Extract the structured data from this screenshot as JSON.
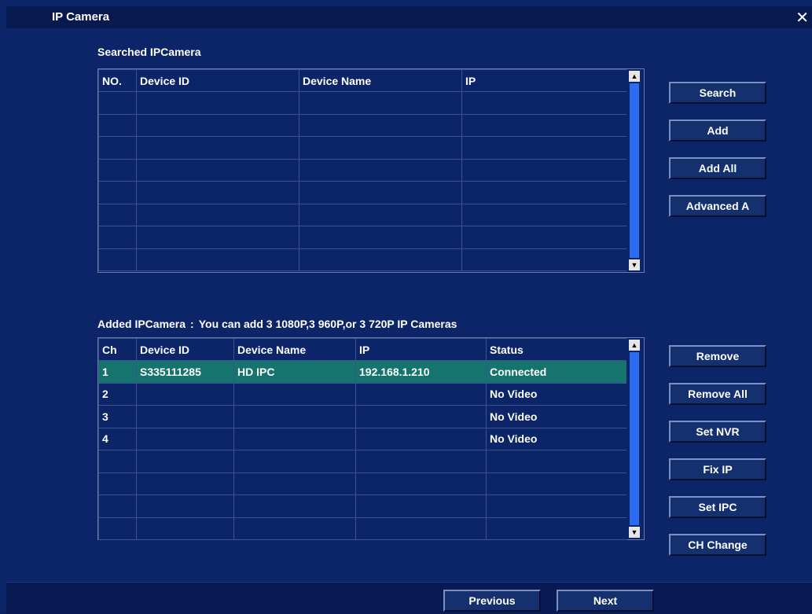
{
  "window": {
    "title": "IP Camera",
    "close_glyph": "✕"
  },
  "searched": {
    "label": "Searched IPCamera",
    "columns": [
      "NO.",
      "Device ID",
      "Device Name",
      "IP"
    ],
    "rows": [
      [
        "",
        "",
        "",
        ""
      ],
      [
        "",
        "",
        "",
        ""
      ],
      [
        "",
        "",
        "",
        ""
      ],
      [
        "",
        "",
        "",
        ""
      ],
      [
        "",
        "",
        "",
        ""
      ],
      [
        "",
        "",
        "",
        ""
      ],
      [
        "",
        "",
        "",
        ""
      ],
      [
        "",
        "",
        "",
        ""
      ]
    ]
  },
  "searched_buttons": {
    "search": "Search",
    "add": "Add",
    "add_all": "Add All",
    "advanced": "Advanced A"
  },
  "added": {
    "label_prefix": "Added IPCamera",
    "label_sep": ":",
    "label_note": "You can add 3 1080P,3 960P,or 3 720P IP Cameras",
    "columns": [
      "Ch",
      "Device ID",
      "Device Name",
      "IP",
      "Status"
    ],
    "rows": [
      [
        "1",
        "S335111285",
        "HD IPC",
        "192.168.1.210",
        "Connected"
      ],
      [
        "2",
        "",
        "",
        "",
        "No Video"
      ],
      [
        "3",
        "",
        "",
        "",
        "No Video"
      ],
      [
        "4",
        "",
        "",
        "",
        "No Video"
      ],
      [
        "",
        "",
        "",
        "",
        ""
      ],
      [
        "",
        "",
        "",
        "",
        ""
      ],
      [
        "",
        "",
        "",
        "",
        ""
      ],
      [
        "",
        "",
        "",
        "",
        ""
      ]
    ],
    "selected_row": 0
  },
  "added_buttons": {
    "remove": "Remove",
    "remove_all": "Remove All",
    "set_nvr": "Set NVR",
    "fix_ip": "Fix IP",
    "set_ipc": "Set IPC",
    "ch_change": "CH Change"
  },
  "footer": {
    "previous": "Previous",
    "next": "Next"
  },
  "icons": {
    "scroll_up": "▲",
    "scroll_down": "▼"
  },
  "colors": {
    "background": "#0c2468",
    "selected_row": "#16746f",
    "scrollbar": "#2b6cf0"
  }
}
